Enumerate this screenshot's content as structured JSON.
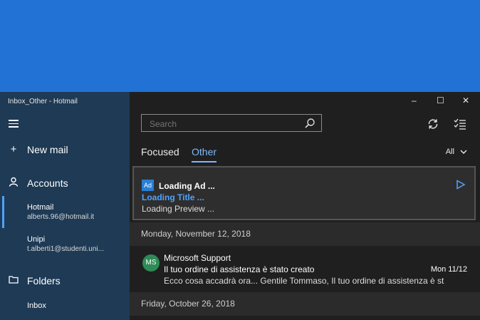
{
  "window": {
    "title": "Inbox_Other - Hotmail",
    "controls": {
      "minimize": "–",
      "maximize": "☐",
      "close": "✕"
    }
  },
  "sidebar": {
    "new_mail": "New mail",
    "accounts_label": "Accounts",
    "accounts": [
      {
        "name": "Hotmail",
        "email": "alberts.96@hotmail.it"
      },
      {
        "name": "Unipi",
        "email": "t.alberti1@studenti.uni..."
      }
    ],
    "folders_label": "Folders",
    "folders": [
      "Inbox"
    ]
  },
  "search": {
    "placeholder": "Search"
  },
  "tabs": {
    "focused": "Focused",
    "other": "Other"
  },
  "filter": {
    "label": "All"
  },
  "ad": {
    "badge": "Ad",
    "title": "Loading Ad ...",
    "loading_title": "Loading Title ...",
    "preview": "Loading Preview ..."
  },
  "messages": {
    "date_header_1": "Monday, November 12, 2018",
    "date_header_2": "Friday, October 26, 2018",
    "items": [
      {
        "avatar": "MS",
        "from": "Microsoft Support",
        "subject": "Il tuo ordine di assistenza è stato creato",
        "date": "Mon 11/12",
        "preview": "Ecco cosa accadrà ora... Gentile Tommaso, Il tuo ordine di assistenza è st"
      }
    ]
  },
  "colors": {
    "background": "#2272d6",
    "sidebar": "#1e3a55",
    "accent": "#4ea3ff",
    "ad_badge": "#2a7fd4",
    "avatar": "#2e8b57"
  }
}
